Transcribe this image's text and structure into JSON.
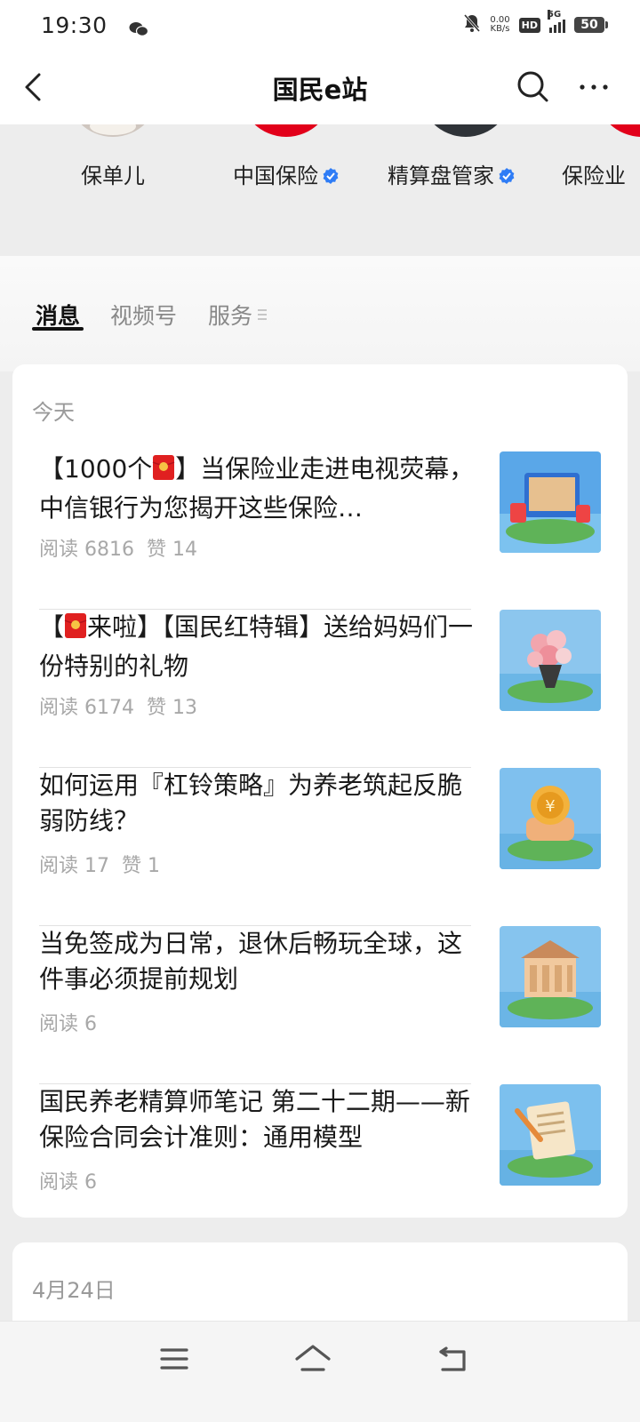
{
  "status_bar": {
    "time": "19:30",
    "net_speed_value": "0.00",
    "net_speed_unit": "KB/s",
    "hd": "HD",
    "network": "5G",
    "battery": "50"
  },
  "nav": {
    "title": "国民e站"
  },
  "accounts": [
    {
      "label": "保单儿",
      "verified": false
    },
    {
      "label": "中国保险",
      "verified": true
    },
    {
      "label": "精算盘管家",
      "verified": true
    },
    {
      "label": "保险业",
      "verified": false
    }
  ],
  "tabs": [
    {
      "label": "消息",
      "active": true
    },
    {
      "label": "视频号",
      "active": false
    },
    {
      "label": "服务",
      "active": false
    }
  ],
  "sections": [
    {
      "date": "今天",
      "articles": [
        {
          "title_prefix": "【1000个",
          "title_suffix": "】当保险业走进电视荧幕，中信银行为您揭开这些保险…",
          "reads": "阅读 6816",
          "likes": "赞 14",
          "thumb": "tv-island"
        },
        {
          "title_prefix": "【",
          "title_suffix": "来啦】【国民红特辑】送给妈妈们一份特别的礼物",
          "reads": "阅读 6174",
          "likes": "赞 13",
          "thumb": "flowers-island"
        },
        {
          "title_prefix": "",
          "title_suffix": "如何运用『杠铃策略』为养老筑起反脆弱防线？",
          "reads": "阅读 17",
          "likes": "赞 1",
          "thumb": "coin-island"
        },
        {
          "title_prefix": "",
          "title_suffix": "当免签成为日常，退休后畅玩全球，这件事必须提前规划",
          "reads": "阅读 6",
          "likes": "",
          "thumb": "building-island"
        },
        {
          "title_prefix": "",
          "title_suffix": "国民养老精算师笔记 第二十二期——新保险合同会计准则：通用模型",
          "reads": "阅读 6",
          "likes": "",
          "thumb": "scroll-island"
        }
      ]
    },
    {
      "date": "4月24日",
      "articles": []
    }
  ],
  "icons": {
    "back": "chevron-left-icon",
    "search": "search-icon",
    "more": "more-dots-icon",
    "menu": "menu-icon",
    "home": "home-icon",
    "return": "return-icon",
    "red_packet": "red-packet-icon",
    "verified": "verified-badge-icon"
  },
  "colors": {
    "page_bg": "#ededed",
    "card_bg": "#ffffff",
    "meta_text": "#a8a8a8",
    "verified_blue": "#2e7cf6",
    "red_packet": "#e02020"
  }
}
